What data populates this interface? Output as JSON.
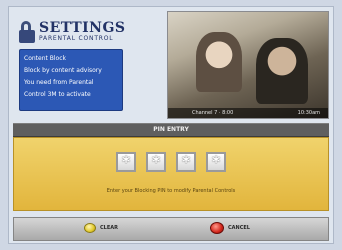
{
  "settings": {
    "title": "SETTINGS",
    "subtitle": "PARENTAL CONTROL",
    "menu": [
      "Content Block",
      "Block by content advisory",
      "You need from Parental",
      "Control 3M to activate"
    ]
  },
  "preview": {
    "left_info": "Channel 7  ·  8:00",
    "right_info": "10:30am"
  },
  "pin_entry": {
    "header": "PIN ENTRY",
    "digits": [
      "*",
      "*",
      "*",
      "*"
    ],
    "prompt": "Enter your Blocking PIN to modify Parental Controls"
  },
  "buttons": {
    "clear_label": "CLEAR",
    "cancel_label": "CANCEL"
  },
  "colors": {
    "menu_blue": "#2c58b5",
    "pin_yellow": "#e2b53c",
    "clear_button": "#e2c92c",
    "cancel_button": "#d3261b"
  },
  "icons": {
    "lock": "lock-icon",
    "clear": "yellow-circle-button-icon",
    "cancel": "red-circle-button-icon"
  }
}
